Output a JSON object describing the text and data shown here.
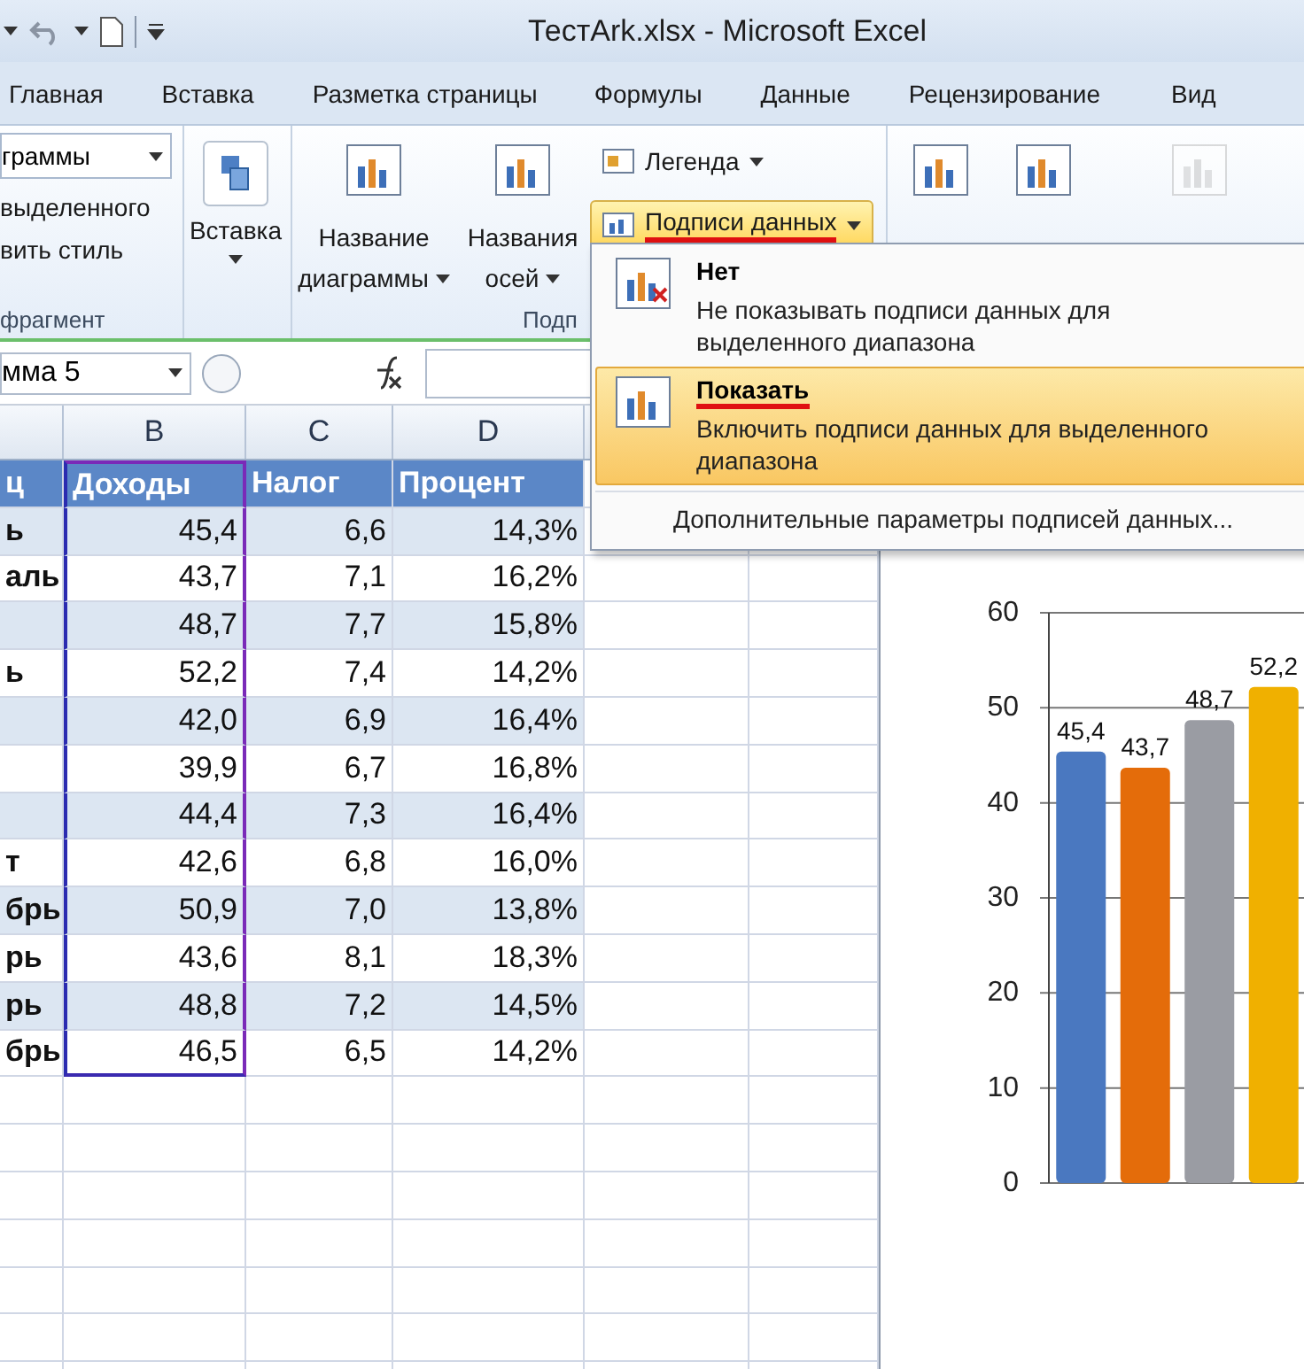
{
  "title_bar": {
    "title": "ТестArk.xlsx - Microsoft Excel"
  },
  "tabs": [
    {
      "label": "Главная",
      "selected": false
    },
    {
      "label": "Вставка",
      "selected": false
    },
    {
      "label": "Разметка страницы",
      "selected": false
    },
    {
      "label": "Формулы",
      "selected": false
    },
    {
      "label": "Данные",
      "selected": false
    },
    {
      "label": "Рецензирование",
      "selected": false
    },
    {
      "label": "Вид",
      "selected": false
    }
  ],
  "ribbon": {
    "clipboard_group": {
      "style_combo": "граммы",
      "lines": [
        "выделенного",
        "вить стиль"
      ],
      "label": "фрагмент"
    },
    "insert_group": {
      "button": "Вставка"
    },
    "labels_group": {
      "label": "Подп",
      "buttons": [
        {
          "lines": [
            "Название",
            "диаграммы"
          ]
        },
        {
          "lines": [
            "Названия",
            "осей"
          ]
        }
      ],
      "legend": "Легенда",
      "data_labels": {
        "label": "Подписи данных",
        "open": true,
        "annotated": true
      }
    },
    "axes_group": {
      "buttons": [
        {
          "disabled": false
        },
        {
          "disabled": false
        },
        {
          "disabled": true
        }
      ]
    }
  },
  "formula_bar": {
    "name_box": "мма 5"
  },
  "sheet": {
    "columns": [
      {
        "label": "B",
        "in_range": true
      },
      {
        "label": "C",
        "in_range": false
      },
      {
        "label": "D",
        "in_range": false
      }
    ],
    "header_row": [
      "ц",
      "Доходы",
      "Налог",
      "Процент"
    ],
    "rows": [
      [
        "ь",
        "45,4",
        "6,6",
        "14,3%"
      ],
      [
        "аль",
        "43,7",
        "7,1",
        "16,2%"
      ],
      [
        "",
        "48,7",
        "7,7",
        "15,8%"
      ],
      [
        "ь",
        "52,2",
        "7,4",
        "14,2%"
      ],
      [
        "",
        "42,0",
        "6,9",
        "16,4%"
      ],
      [
        "",
        "39,9",
        "6,7",
        "16,8%"
      ],
      [
        "",
        "44,4",
        "7,3",
        "16,4%"
      ],
      [
        "т",
        "42,6",
        "6,8",
        "16,0%"
      ],
      [
        "брь",
        "50,9",
        "7,0",
        "13,8%"
      ],
      [
        "рь",
        "43,6",
        "8,1",
        "18,3%"
      ],
      [
        "рь",
        "48,8",
        "7,2",
        "14,5%"
      ],
      [
        "брь",
        "46,5",
        "6,5",
        "14,2%"
      ]
    ]
  },
  "chart": {
    "chart_data": {
      "type": "bar",
      "values": [
        45.4,
        43.7,
        48.7,
        52.2
      ],
      "ylim": [
        0,
        60
      ],
      "yticks": [
        0,
        10,
        20,
        30,
        40,
        50,
        60
      ],
      "value_labels": [
        "45,4",
        "43,7",
        "48,7",
        "52,2"
      ],
      "grid": true
    }
  },
  "data_labels_menu": {
    "items": [
      {
        "title": "Нет",
        "description": "Не показывать подписи данных для выделенного диапазона",
        "selected": false,
        "annotated": false,
        "kind": "none"
      },
      {
        "title": "Показать",
        "description": "Включить подписи данных для выделенного диапазона",
        "selected": true,
        "annotated": true,
        "kind": "show"
      }
    ],
    "more": "Дополнительные параметры подписей данных..."
  }
}
